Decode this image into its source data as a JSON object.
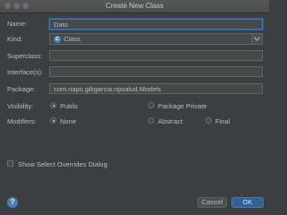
{
  "window": {
    "title": "Create New Class"
  },
  "form": {
    "name_label": "Name:",
    "name_value": "Dato",
    "kind_label": "Kind:",
    "kind_value": "Class",
    "kind_icon_letter": "C",
    "superclass_label": "Superclass:",
    "superclass_value": "",
    "interfaces_label": "Interface(s):",
    "interfaces_value": "",
    "package_label": "Package:",
    "package_value": "com.naps.gibgarcia.npsalud.Models",
    "visibility_label": "Visibility:",
    "visibility_options": [
      "Public",
      "Package Private"
    ],
    "visibility_selected": "Public",
    "modifiers_label": "Modifiers:",
    "modifiers_options": [
      "None",
      "Abstract",
      "Final"
    ],
    "modifiers_selected": "None",
    "show_overrides_label": "Show Select Overrides Dialog",
    "show_overrides_checked": false
  },
  "footer": {
    "help_symbol": "?",
    "cancel_label": "Cancel",
    "ok_label": "OK"
  },
  "colors": {
    "background": "#3c3f41",
    "accent": "#365f94",
    "focus_border": "#3d74b8",
    "class_icon": "#4a82b8"
  }
}
